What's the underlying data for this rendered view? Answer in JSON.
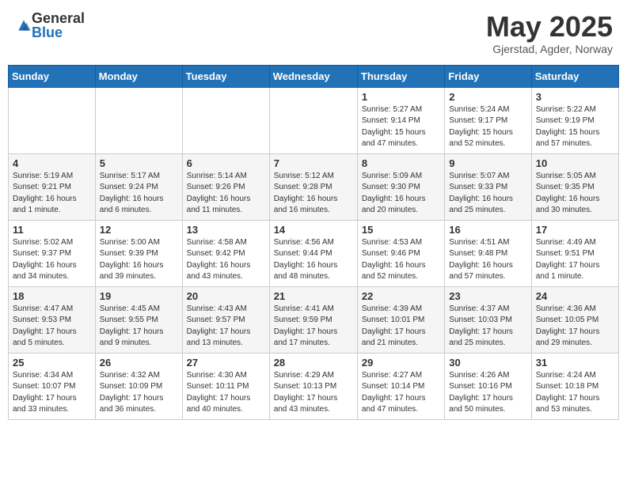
{
  "header": {
    "logo_general": "General",
    "logo_blue": "Blue",
    "month_title": "May 2025",
    "location": "Gjerstad, Agder, Norway"
  },
  "weekdays": [
    "Sunday",
    "Monday",
    "Tuesday",
    "Wednesday",
    "Thursday",
    "Friday",
    "Saturday"
  ],
  "weeks": [
    [
      {
        "day": "",
        "info": ""
      },
      {
        "day": "",
        "info": ""
      },
      {
        "day": "",
        "info": ""
      },
      {
        "day": "",
        "info": ""
      },
      {
        "day": "1",
        "info": "Sunrise: 5:27 AM\nSunset: 9:14 PM\nDaylight: 15 hours\nand 47 minutes."
      },
      {
        "day": "2",
        "info": "Sunrise: 5:24 AM\nSunset: 9:17 PM\nDaylight: 15 hours\nand 52 minutes."
      },
      {
        "day": "3",
        "info": "Sunrise: 5:22 AM\nSunset: 9:19 PM\nDaylight: 15 hours\nand 57 minutes."
      }
    ],
    [
      {
        "day": "4",
        "info": "Sunrise: 5:19 AM\nSunset: 9:21 PM\nDaylight: 16 hours\nand 1 minute."
      },
      {
        "day": "5",
        "info": "Sunrise: 5:17 AM\nSunset: 9:24 PM\nDaylight: 16 hours\nand 6 minutes."
      },
      {
        "day": "6",
        "info": "Sunrise: 5:14 AM\nSunset: 9:26 PM\nDaylight: 16 hours\nand 11 minutes."
      },
      {
        "day": "7",
        "info": "Sunrise: 5:12 AM\nSunset: 9:28 PM\nDaylight: 16 hours\nand 16 minutes."
      },
      {
        "day": "8",
        "info": "Sunrise: 5:09 AM\nSunset: 9:30 PM\nDaylight: 16 hours\nand 20 minutes."
      },
      {
        "day": "9",
        "info": "Sunrise: 5:07 AM\nSunset: 9:33 PM\nDaylight: 16 hours\nand 25 minutes."
      },
      {
        "day": "10",
        "info": "Sunrise: 5:05 AM\nSunset: 9:35 PM\nDaylight: 16 hours\nand 30 minutes."
      }
    ],
    [
      {
        "day": "11",
        "info": "Sunrise: 5:02 AM\nSunset: 9:37 PM\nDaylight: 16 hours\nand 34 minutes."
      },
      {
        "day": "12",
        "info": "Sunrise: 5:00 AM\nSunset: 9:39 PM\nDaylight: 16 hours\nand 39 minutes."
      },
      {
        "day": "13",
        "info": "Sunrise: 4:58 AM\nSunset: 9:42 PM\nDaylight: 16 hours\nand 43 minutes."
      },
      {
        "day": "14",
        "info": "Sunrise: 4:56 AM\nSunset: 9:44 PM\nDaylight: 16 hours\nand 48 minutes."
      },
      {
        "day": "15",
        "info": "Sunrise: 4:53 AM\nSunset: 9:46 PM\nDaylight: 16 hours\nand 52 minutes."
      },
      {
        "day": "16",
        "info": "Sunrise: 4:51 AM\nSunset: 9:48 PM\nDaylight: 16 hours\nand 57 minutes."
      },
      {
        "day": "17",
        "info": "Sunrise: 4:49 AM\nSunset: 9:51 PM\nDaylight: 17 hours\nand 1 minute."
      }
    ],
    [
      {
        "day": "18",
        "info": "Sunrise: 4:47 AM\nSunset: 9:53 PM\nDaylight: 17 hours\nand 5 minutes."
      },
      {
        "day": "19",
        "info": "Sunrise: 4:45 AM\nSunset: 9:55 PM\nDaylight: 17 hours\nand 9 minutes."
      },
      {
        "day": "20",
        "info": "Sunrise: 4:43 AM\nSunset: 9:57 PM\nDaylight: 17 hours\nand 13 minutes."
      },
      {
        "day": "21",
        "info": "Sunrise: 4:41 AM\nSunset: 9:59 PM\nDaylight: 17 hours\nand 17 minutes."
      },
      {
        "day": "22",
        "info": "Sunrise: 4:39 AM\nSunset: 10:01 PM\nDaylight: 17 hours\nand 21 minutes."
      },
      {
        "day": "23",
        "info": "Sunrise: 4:37 AM\nSunset: 10:03 PM\nDaylight: 17 hours\nand 25 minutes."
      },
      {
        "day": "24",
        "info": "Sunrise: 4:36 AM\nSunset: 10:05 PM\nDaylight: 17 hours\nand 29 minutes."
      }
    ],
    [
      {
        "day": "25",
        "info": "Sunrise: 4:34 AM\nSunset: 10:07 PM\nDaylight: 17 hours\nand 33 minutes."
      },
      {
        "day": "26",
        "info": "Sunrise: 4:32 AM\nSunset: 10:09 PM\nDaylight: 17 hours\nand 36 minutes."
      },
      {
        "day": "27",
        "info": "Sunrise: 4:30 AM\nSunset: 10:11 PM\nDaylight: 17 hours\nand 40 minutes."
      },
      {
        "day": "28",
        "info": "Sunrise: 4:29 AM\nSunset: 10:13 PM\nDaylight: 17 hours\nand 43 minutes."
      },
      {
        "day": "29",
        "info": "Sunrise: 4:27 AM\nSunset: 10:14 PM\nDaylight: 17 hours\nand 47 minutes."
      },
      {
        "day": "30",
        "info": "Sunrise: 4:26 AM\nSunset: 10:16 PM\nDaylight: 17 hours\nand 50 minutes."
      },
      {
        "day": "31",
        "info": "Sunrise: 4:24 AM\nSunset: 10:18 PM\nDaylight: 17 hours\nand 53 minutes."
      }
    ]
  ]
}
